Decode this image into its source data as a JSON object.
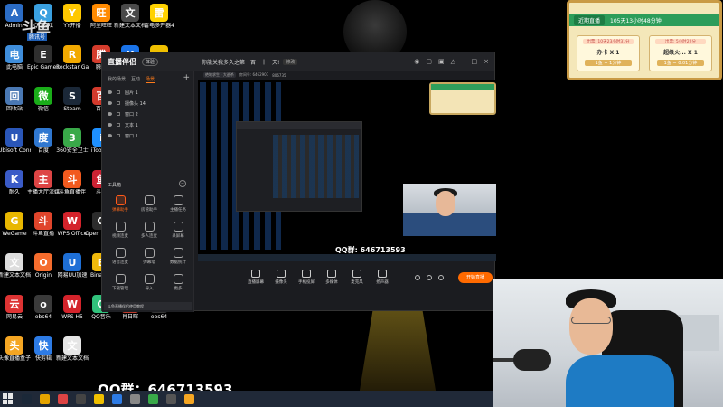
{
  "desktop": {
    "icons": [
      {
        "label": "Admini",
        "color": "#2b6cc4",
        "glyph": "A"
      },
      {
        "label": "QQ游戏",
        "color": "#3aa0e0",
        "glyph": "Q"
      },
      {
        "label": "YY开播",
        "color": "#ffc800",
        "glyph": "Y"
      },
      {
        "label": "阿里旺旺",
        "color": "#ff8a00",
        "glyph": "旺"
      },
      {
        "label": "新建文本文档 (3)",
        "color": "#4a4a4a",
        "glyph": "文"
      },
      {
        "label": "雷电多开器4",
        "color": "#ffd200",
        "glyph": "雷"
      },
      {
        "label": "此电脑",
        "color": "#3f8edb",
        "glyph": "电"
      },
      {
        "label": "Epic Games Launcher",
        "color": "#2f2f2f",
        "glyph": "E"
      },
      {
        "label": "Rockstar Games...",
        "color": "#f2a900",
        "glyph": "R"
      },
      {
        "label": "腾讯",
        "color": "#d43c2c",
        "glyph": "腾"
      },
      {
        "label": "K",
        "color": "#1a73e8",
        "glyph": "K"
      },
      {
        "label": "",
        "color": "#f0c000",
        "glyph": "●"
      },
      {
        "label": "回收站",
        "color": "#4a78b3",
        "glyph": "回"
      },
      {
        "label": "微信",
        "color": "#1aad19",
        "glyph": "微"
      },
      {
        "label": "Steam",
        "color": "#1b2838",
        "glyph": "S"
      },
      {
        "label": "百度",
        "color": "#d33a2c",
        "glyph": "百"
      },
      {
        "label": "网络",
        "color": "#4f94d4",
        "glyph": "网"
      },
      {
        "label": "Google Chrome",
        "color": "#e5a400",
        "glyph": "G"
      },
      {
        "label": "Ubisoft Connect",
        "color": "#2a56b8",
        "glyph": "U"
      },
      {
        "label": "百度",
        "color": "#2f77d0",
        "glyph": "度"
      },
      {
        "label": "360安全卫士",
        "color": "#39a949",
        "glyph": "3"
      },
      {
        "label": "iTools 4",
        "color": "#1e90ff",
        "glyph": "i"
      },
      {
        "label": "5E对战平台",
        "color": "#444",
        "glyph": "5"
      },
      {
        "label": "图",
        "color": "#5b6c9a",
        "glyph": "图"
      },
      {
        "label": "耐久",
        "color": "#3a5bc7",
        "glyph": "K"
      },
      {
        "label": "主播大厅流媒体",
        "color": "#d44",
        "glyph": "主"
      },
      {
        "label": "斗鱼直播伴",
        "color": "#f25a1e",
        "glyph": "斗"
      },
      {
        "label": "斗鱼",
        "color": "#c23",
        "glyph": "鱼"
      },
      {
        "label": "福影",
        "color": "#3c4fb5",
        "glyph": "K"
      },
      {
        "label": "推乐乐",
        "color": "#7e57c2",
        "glyph": "W"
      },
      {
        "label": "WeGame",
        "color": "#e8b700",
        "glyph": "G"
      },
      {
        "label": "斗鱼直播",
        "color": "#e0452b",
        "glyph": "斗"
      },
      {
        "label": "WPS Office",
        "color": "#d4232b",
        "glyph": "W"
      },
      {
        "label": "Open Broadcast...",
        "color": "#2c2c2c",
        "glyph": "O"
      },
      {
        "label": "爱奇艺",
        "color": "#00b140",
        "glyph": "艺"
      },
      {
        "label": "",
        "color": "#555",
        "glyph": "·"
      },
      {
        "label": "新建文本文档 (5)",
        "color": "#ddd",
        "glyph": "文"
      },
      {
        "label": "Origin",
        "color": "#f56c2d",
        "glyph": "O"
      },
      {
        "label": "网易UU加速",
        "color": "#1e6fd6",
        "glyph": "U"
      },
      {
        "label": "Binance",
        "color": "#f0b90b",
        "glyph": "B"
      },
      {
        "label": "新建文本文档",
        "color": "#ddd",
        "glyph": "文"
      },
      {
        "label": "QQ音乐",
        "color": "#fcd535",
        "glyph": "♪"
      },
      {
        "label": "网易云",
        "color": "#d33",
        "glyph": "云"
      },
      {
        "label": "obs64",
        "color": "#3a3a3a",
        "glyph": "o"
      },
      {
        "label": "WPS H5",
        "color": "#d4232b",
        "glyph": "W"
      },
      {
        "label": "QQ音乐",
        "color": "#31c27c",
        "glyph": "Q"
      },
      {
        "label": "肖日晖",
        "color": "#c0392b",
        "glyph": "肖"
      },
      {
        "label": "obs64",
        "color": "#333",
        "glyph": "●"
      },
      {
        "label": "头像直播盒子",
        "color": "#f5a623",
        "glyph": "头"
      },
      {
        "label": "快剪辑",
        "color": "#2d7be5",
        "glyph": "快"
      },
      {
        "label": "新建文本文档 (6)",
        "color": "#e5e5e5",
        "glyph": "文"
      }
    ]
  },
  "corner_logo": {
    "main": "斗鱼",
    "sub": "腾讯号"
  },
  "app": {
    "logo": "直播伴侣",
    "badge": "体验",
    "room_title": "你能关我多久之第一百一十一天!",
    "room_edit": "修改",
    "info": [
      "绝地求生 · 大逃杀",
      "房间号: 6462907",
      "806735"
    ],
    "tabs": [
      "我的场景",
      "互动",
      "场景"
    ],
    "active_tab": 2,
    "scenes": [
      "图片 1",
      "摄像头 14",
      "窗口 2",
      "文本 1",
      "窗口 1"
    ],
    "toolbox_title": "工具箱",
    "tools": [
      {
        "label": "弹幕助手",
        "hot": true
      },
      {
        "label": "房管助手",
        "hot": false
      },
      {
        "label": "主播任务",
        "hot": false
      },
      {
        "label": "视频连麦",
        "hot": false
      },
      {
        "label": "多人连麦",
        "hot": false
      },
      {
        "label": "录屏幕",
        "hot": false
      },
      {
        "label": "语音连麦",
        "hot": false
      },
      {
        "label": "弹幕墙",
        "hot": false
      },
      {
        "label": "数据统计",
        "hot": false
      },
      {
        "label": "下载管理",
        "hot": false
      },
      {
        "label": "导入",
        "hot": false
      },
      {
        "label": "更多",
        "hot": false
      }
    ],
    "footer": "斗鱼直播伴侣使用教程",
    "preview_qq": "QQ群: 646713593",
    "controls": [
      "直播屏幕",
      "摄像头",
      "手机投屏",
      "多媒体",
      "麦克风",
      "扬声器"
    ],
    "go_live": "开始直播"
  },
  "overlay": {
    "label": "近期直播",
    "timer": "105天13小时48分钟",
    "boxes": [
      {
        "caption": "出票: 10天23小时31分",
        "item": "办卡 X 1",
        "rate": "1鱼 = 1分钟"
      },
      {
        "caption": "出票: 5小时22分",
        "item": "超级火... X 1",
        "rate": "1鱼 = 0.01分钟"
      }
    ]
  },
  "qq_caption": "QQ群：646713593",
  "taskbar": {
    "apps": [
      {
        "name": "steam",
        "color": "#1b2838"
      },
      {
        "name": "chrome",
        "color": "#e5a400"
      },
      {
        "name": "app-a",
        "color": "#d44"
      },
      {
        "name": "app-b",
        "color": "#444"
      },
      {
        "name": "app-c",
        "color": "#f0c000"
      },
      {
        "name": "app-d",
        "color": "#2d7be5"
      },
      {
        "name": "app-e",
        "color": "#888"
      },
      {
        "name": "app-f",
        "color": "#39a949"
      },
      {
        "name": "app-g",
        "color": "#555"
      },
      {
        "name": "app-h",
        "color": "#f5a623"
      }
    ]
  }
}
